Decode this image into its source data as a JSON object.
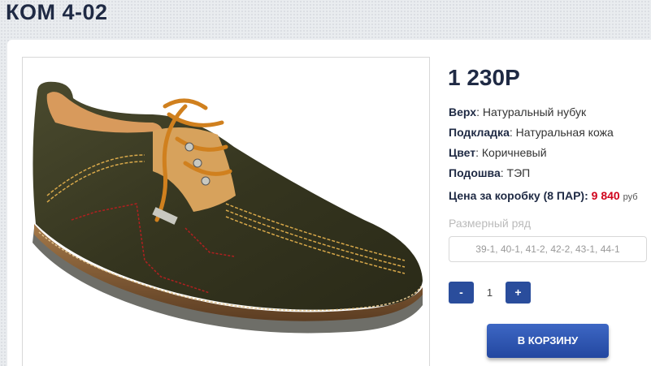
{
  "product": {
    "title": "КОМ 4-02",
    "price": "1 230Р",
    "photo_icon": "shoe-photo"
  },
  "specs": {
    "upper_label": "Верх",
    "upper_value": ": Натуральный нубук",
    "lining_label": "Подкладка",
    "lining_value": ": Натуральная кожа",
    "color_label": "Цвет",
    "color_value": ": Коричневый",
    "sole_label": "Подошва",
    "sole_value": ": ТЭП"
  },
  "box_price": {
    "label": "Цена за коробку (8 ПАР):",
    "value": "9 840",
    "currency": "руб"
  },
  "sizes": {
    "label": "Размерный ряд",
    "value": "39-1, 40-1, 41-2, 42-2, 43-1, 44-1"
  },
  "quantity": {
    "minus": "-",
    "value": "1",
    "plus": "+"
  },
  "cart_button": "В КОРЗИНУ",
  "colors": {
    "accent": "#2a4d9c",
    "price_red": "#d0021b",
    "title": "#1f2a44"
  }
}
